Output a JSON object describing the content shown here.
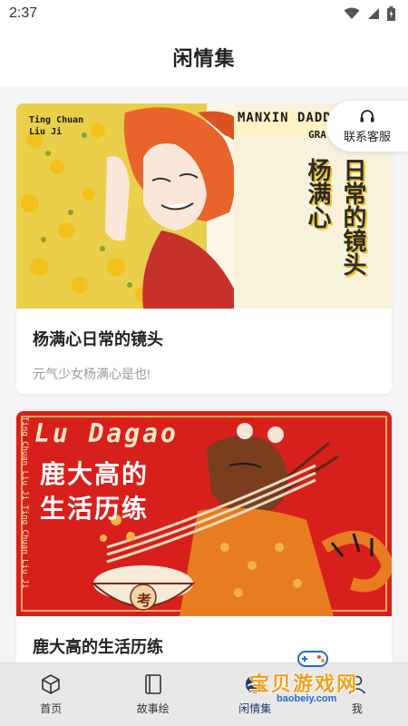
{
  "status_bar": {
    "time": "2:37"
  },
  "header": {
    "title": "闲情集"
  },
  "service": {
    "label": "联系客服",
    "icon": "headset-icon"
  },
  "cards": [
    {
      "title": "杨满心日常的镜头",
      "description": "元气少女杨满心是也!",
      "image": {
        "corner_text_1": "Ting Chuan",
        "corner_text_2": "Liu Ji",
        "banner_text": "MANXIN DADDY",
        "banner_text_2": "GRA",
        "vertical_1": "杨满心",
        "vertical_2": "日常的镜头"
      }
    },
    {
      "title": "鹿大高的生活历练",
      "description": "",
      "image": {
        "heading_en": "Lu Dagao",
        "heading_cn_1": "鹿大高的",
        "heading_cn_2": "生活历练",
        "side_text": "Ting Chuan Liu Ji Ting Chuan Liu Ji",
        "bowl_text": "考"
      }
    }
  ],
  "bottom_nav": [
    {
      "label": "首页",
      "icon": "cube-icon"
    },
    {
      "label": "故事绘",
      "icon": "book-icon"
    },
    {
      "label": "闲情集",
      "icon": "circle-icon"
    },
    {
      "label": "我",
      "icon": "user-icon"
    }
  ],
  "watermark": {
    "text": "宝贝游戏网",
    "url": "baobeiy.com"
  },
  "colors": {
    "accent": "#1e3a6e",
    "poster_red": "#d7201c",
    "flower_yellow": "#f3c21a"
  }
}
